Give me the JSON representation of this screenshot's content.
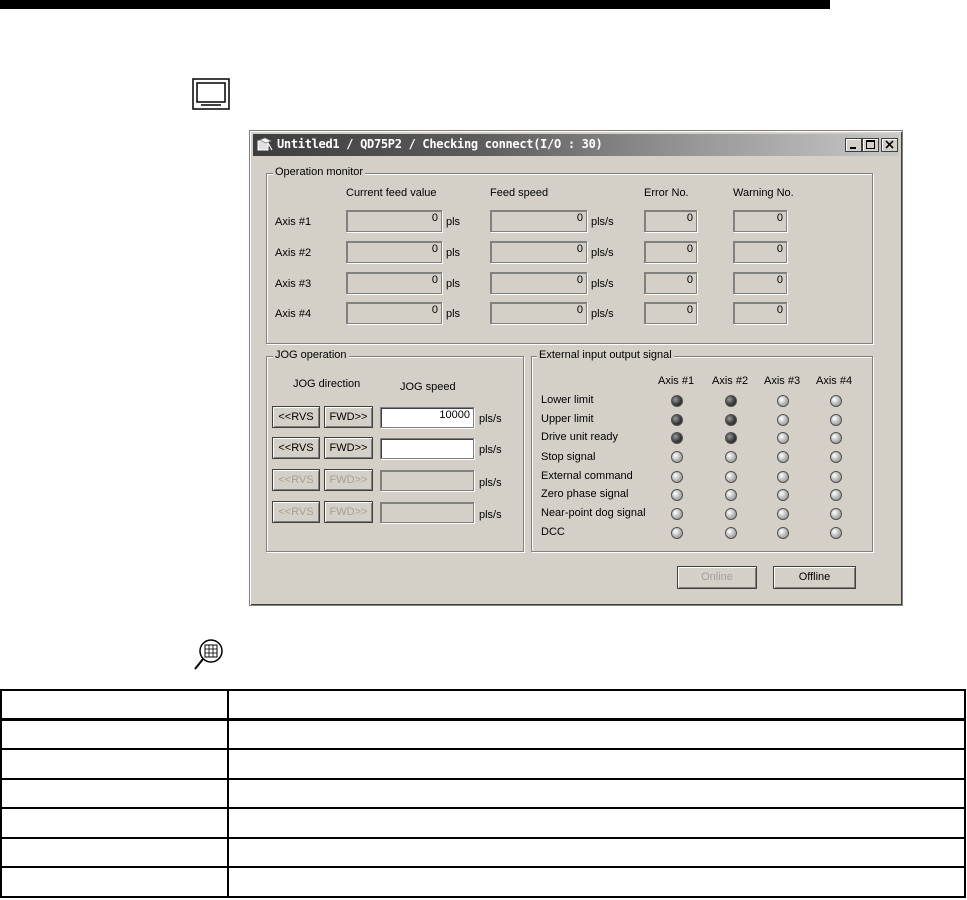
{
  "window": {
    "title": "Untitled1 / QD75P2 / Checking connect(I/O : 30)"
  },
  "operation_monitor": {
    "legend": "Operation monitor",
    "headers": {
      "current_feed_value": "Current feed value",
      "feed_speed": "Feed speed",
      "error_no": "Error No.",
      "warning_no": "Warning No."
    },
    "rows": [
      {
        "axis": "Axis #1",
        "current": "0",
        "current_unit": "pls",
        "speed": "0",
        "speed_unit": "pls/s",
        "error": "0",
        "warning": "0"
      },
      {
        "axis": "Axis #2",
        "current": "0",
        "current_unit": "pls",
        "speed": "0",
        "speed_unit": "pls/s",
        "error": "0",
        "warning": "0"
      },
      {
        "axis": "Axis #3",
        "current": "0",
        "current_unit": "pls",
        "speed": "0",
        "speed_unit": "pls/s",
        "error": "0",
        "warning": "0"
      },
      {
        "axis": "Axis #4",
        "current": "0",
        "current_unit": "pls",
        "speed": "0",
        "speed_unit": "pls/s",
        "error": "0",
        "warning": "0"
      }
    ]
  },
  "jog": {
    "legend": "JOG operation",
    "direction_label": "JOG direction",
    "speed_label": "JOG speed",
    "rows": [
      {
        "rvs": "<<RVS",
        "fwd": "FWD>>",
        "speed": "10000",
        "unit": "pls/s",
        "enabled": true
      },
      {
        "rvs": "<<RVS",
        "fwd": "FWD>>",
        "speed": "",
        "unit": "pls/s",
        "enabled": true
      },
      {
        "rvs": "<<RVS",
        "fwd": "FWD>>",
        "speed": "",
        "unit": "pls/s",
        "enabled": false
      },
      {
        "rvs": "<<RVS",
        "fwd": "FWD>>",
        "speed": "",
        "unit": "pls/s",
        "enabled": false
      }
    ]
  },
  "external_signals": {
    "legend": "External input output signal",
    "axes": [
      "Axis #1",
      "Axis #2",
      "Axis #3",
      "Axis #4"
    ],
    "signals": [
      {
        "label": "Lower limit",
        "states": [
          "on",
          "on",
          "off",
          "off"
        ]
      },
      {
        "label": "Upper limit",
        "states": [
          "on",
          "on",
          "off",
          "off"
        ]
      },
      {
        "label": "Drive unit ready",
        "states": [
          "on",
          "on",
          "off",
          "off"
        ]
      },
      {
        "label": "Stop signal",
        "states": [
          "off",
          "off",
          "off",
          "off"
        ]
      },
      {
        "label": "External command",
        "states": [
          "off",
          "off",
          "off",
          "off"
        ]
      },
      {
        "label": "Zero phase signal",
        "states": [
          "off",
          "off",
          "off",
          "off"
        ]
      },
      {
        "label": "Near-point dog signal",
        "states": [
          "off",
          "off",
          "off",
          "off"
        ]
      },
      {
        "label": "DCC",
        "states": [
          "off",
          "off",
          "off",
          "off"
        ]
      }
    ]
  },
  "buttons": {
    "online": "Online",
    "offline": "Offline"
  },
  "colors": {
    "window_face": "#d4d0c8",
    "led_on": "#3a3a3a",
    "led_off": "#b4b4b4"
  }
}
